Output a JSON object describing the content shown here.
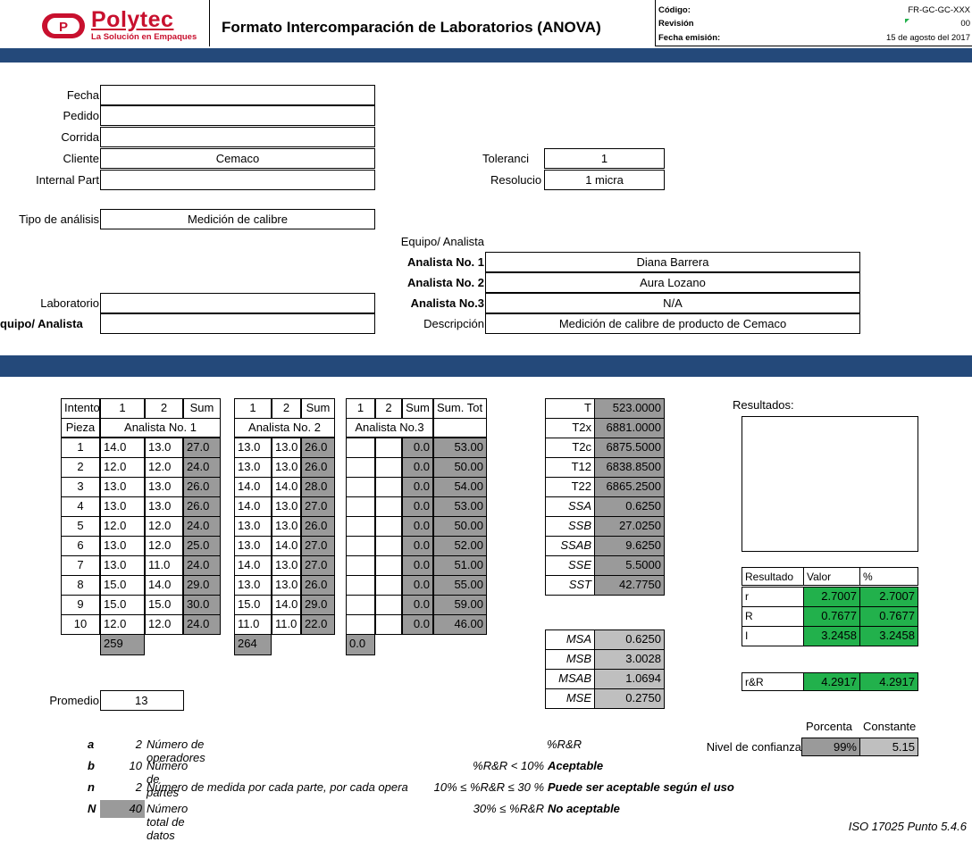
{
  "header": {
    "logo_name": "Polytec",
    "logo_tagline": "La Solución en Empaques",
    "title": "Formato Intercomparación de Laboratorios (ANOVA)",
    "codigo_label": "Código:",
    "codigo_value": "FR-GC-GC-XXX",
    "revision_label": "Revisión",
    "revision_value": "00",
    "fecha_emision_label": "Fecha emisión:",
    "fecha_emision_value": "15 de agosto del 2017"
  },
  "form": {
    "fecha_label": "Fecha",
    "fecha_value": "",
    "pedido_label": "Pedido",
    "pedido_value": "",
    "corrida_label": "Corrida",
    "corrida_value": "",
    "cliente_label": "Cliente",
    "cliente_value": "Cemaco",
    "internal_part_label": "Internal Part",
    "internal_part_value": "",
    "tolerancia_label": "Toleranci",
    "tolerancia_value": "1",
    "resolucion_label": "Resolucio",
    "resolucion_value": "1 micra",
    "tipo_analisis_label": "Tipo de análisis",
    "tipo_analisis_value": "Medición  de calibre",
    "equipo_analista_label": "Equipo/ Analista",
    "analista1_label": "Analista No. 1",
    "analista1_value": "Diana Barrera",
    "analista2_label": "Analista No. 2",
    "analista2_value": "Aura Lozano",
    "analista3_label": "Analista No.3",
    "analista3_value": "N/A",
    "descripcion_label": "Descripción",
    "descripcion_value": "Medición de calibre de producto de Cemaco",
    "laboratorio_label": "Laboratorio",
    "laboratorio_value": "",
    "equipo_label": "quipo/ Analista",
    "equipo_value": ""
  },
  "table": {
    "intento_label": "Intento",
    "pieza_label": "Pieza",
    "h1": "1",
    "h2": "2",
    "hsum": "Sum",
    "sum_tot_label": "Sum. Tot",
    "analista1": "Analista No. 1",
    "analista2": "Analista No. 2",
    "analista3": "Analista No.3",
    "rows": [
      {
        "p": "1",
        "a1": "14.0",
        "a2": "13.0",
        "as": "27.0",
        "b1": "13.0",
        "b2": "13.0",
        "bs": "26.0",
        "c1": "",
        "c2": "",
        "cs": "0.0",
        "tot": "53.00"
      },
      {
        "p": "2",
        "a1": "12.0",
        "a2": "12.0",
        "as": "24.0",
        "b1": "13.0",
        "b2": "13.0",
        "bs": "26.0",
        "c1": "",
        "c2": "",
        "cs": "0.0",
        "tot": "50.00"
      },
      {
        "p": "3",
        "a1": "13.0",
        "a2": "13.0",
        "as": "26.0",
        "b1": "14.0",
        "b2": "14.0",
        "bs": "28.0",
        "c1": "",
        "c2": "",
        "cs": "0.0",
        "tot": "54.00"
      },
      {
        "p": "4",
        "a1": "13.0",
        "a2": "13.0",
        "as": "26.0",
        "b1": "14.0",
        "b2": "13.0",
        "bs": "27.0",
        "c1": "",
        "c2": "",
        "cs": "0.0",
        "tot": "53.00"
      },
      {
        "p": "5",
        "a1": "12.0",
        "a2": "12.0",
        "as": "24.0",
        "b1": "13.0",
        "b2": "13.0",
        "bs": "26.0",
        "c1": "",
        "c2": "",
        "cs": "0.0",
        "tot": "50.00"
      },
      {
        "p": "6",
        "a1": "13.0",
        "a2": "12.0",
        "as": "25.0",
        "b1": "13.0",
        "b2": "14.0",
        "bs": "27.0",
        "c1": "",
        "c2": "",
        "cs": "0.0",
        "tot": "52.00"
      },
      {
        "p": "7",
        "a1": "13.0",
        "a2": "11.0",
        "as": "24.0",
        "b1": "14.0",
        "b2": "13.0",
        "bs": "27.0",
        "c1": "",
        "c2": "",
        "cs": "0.0",
        "tot": "51.00"
      },
      {
        "p": "8",
        "a1": "15.0",
        "a2": "14.0",
        "as": "29.0",
        "b1": "13.0",
        "b2": "13.0",
        "bs": "26.0",
        "c1": "",
        "c2": "",
        "cs": "0.0",
        "tot": "55.00"
      },
      {
        "p": "9",
        "a1": "15.0",
        "a2": "15.0",
        "as": "30.0",
        "b1": "15.0",
        "b2": "14.0",
        "bs": "29.0",
        "c1": "",
        "c2": "",
        "cs": "0.0",
        "tot": "59.00"
      },
      {
        "p": "10",
        "a1": "12.0",
        "a2": "12.0",
        "as": "24.0",
        "b1": "11.0",
        "b2": "11.0",
        "bs": "22.0",
        "c1": "",
        "c2": "",
        "cs": "0.0",
        "tot": "46.00"
      }
    ],
    "total_a": "259",
    "total_b": "264",
    "total_c": "0.0"
  },
  "promedio_label": "Promedio",
  "promedio_value": "13",
  "stats": [
    {
      "label": "T",
      "value": "523.0000",
      "italic": false
    },
    {
      "label": "T2x",
      "value": "6881.0000",
      "italic": false
    },
    {
      "label": "T2c",
      "value": "6875.5000",
      "italic": false
    },
    {
      "label": "T12",
      "value": "6838.8500",
      "italic": false
    },
    {
      "label": "T22",
      "value": "6865.2500",
      "italic": false
    },
    {
      "label": "SSA",
      "value": "0.6250",
      "italic": true
    },
    {
      "label": "SSB",
      "value": "27.0250",
      "italic": true
    },
    {
      "label": "SSAB",
      "value": "9.6250",
      "italic": true
    },
    {
      "label": "SSE",
      "value": "5.5000",
      "italic": true
    },
    {
      "label": "SST",
      "value": "42.7750",
      "italic": true
    }
  ],
  "ms": [
    {
      "label": "MSA",
      "value": "0.6250"
    },
    {
      "label": "MSB",
      "value": "3.0028"
    },
    {
      "label": "MSAB",
      "value": "1.0694"
    },
    {
      "label": "MSE",
      "value": "0.2750"
    }
  ],
  "resultados": {
    "title": "Resultados:",
    "h_resultado": "Resultado",
    "h_valor": "Valor",
    "h_pct": "%",
    "rows": [
      {
        "k": "r",
        "v": "2.7007",
        "p": "2.7007"
      },
      {
        "k": "R",
        "v": "0.7677",
        "p": "0.7677"
      },
      {
        "k": "I",
        "v": "3.2458",
        "p": "3.2458"
      }
    ],
    "rr_label": "r&R",
    "rr_value": "4.2917",
    "rr_pct": "4.2917"
  },
  "confianza": {
    "porcenta_label": "Porcenta",
    "constante_label": "Constante",
    "nivel_label": "Nivel de confianza",
    "porcentaje": "99%",
    "constante": "5.15"
  },
  "legend": [
    {
      "sym": "a",
      "val": "2",
      "text": "Número de operadores"
    },
    {
      "sym": "b",
      "val": "10",
      "text": "Número de partes"
    },
    {
      "sym": "n",
      "val": "2",
      "text": "Número de medida por cada parte, por cada opera"
    },
    {
      "sym": "N",
      "val": "40",
      "text": "Número total de datos"
    }
  ],
  "criteria": {
    "title": "%R&R",
    "c1_cond": "%R&R < 10%",
    "c1_res": "Aceptable",
    "c2_cond": "10% ≤ %R&R ≤ 30 %",
    "c2_res": "Puede ser aceptable según el uso",
    "c3_cond": "30% ≤ %R&R",
    "c3_res": "No aceptable"
  },
  "footer": "ISO 17025  Punto 5.4.6",
  "colors": {
    "band": "#24497a",
    "gray": "#9a9a9a",
    "green": "#22b14c",
    "logo_red": "#c8102e"
  }
}
